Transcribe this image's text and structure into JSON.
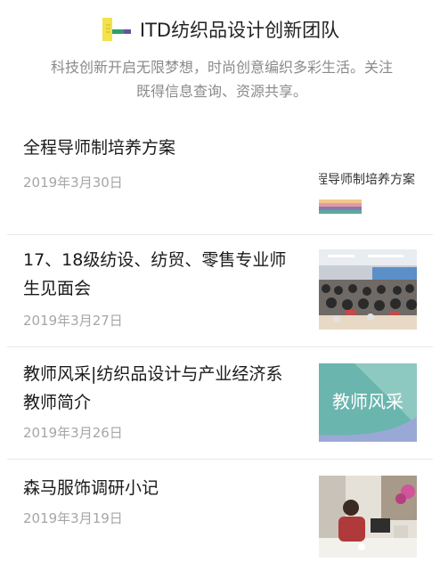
{
  "header": {
    "team_name": "ITD纺织品设计创新团队",
    "description_lines": [
      "科技创新开启无限梦想，时尚创意编织多彩生活。关注",
      "既得信息查询、资源共享。"
    ]
  },
  "articles": [
    {
      "title_lines": [
        "全程导师制培养方案"
      ],
      "date": "2019年3月30日",
      "thumb_text": "程导师制培养方案",
      "thumb_stripe_colors": [
        "#f2c88a",
        "#e39aa6",
        "#8a78b5",
        "#5bab9a"
      ]
    },
    {
      "title_lines": [
        "17、18级纺设、纺贸、零售专业师",
        "生见面会"
      ],
      "date": "2019年3月27日"
    },
    {
      "title_lines": [
        "教师风采|纺织品设计与产业经济系",
        "教师简介"
      ],
      "date": "2019年3月26日",
      "thumb_text": "教师风采"
    },
    {
      "title_lines": [
        "森马服饰调研小记"
      ],
      "date": "2019年3月19日"
    }
  ],
  "colors": {
    "title_text": "#1a1a1a",
    "date_text": "#a6a6a6",
    "description_text": "#8a8a8a",
    "divider": "#e8e8e8",
    "teal_thumb": "#6ab5ad"
  }
}
